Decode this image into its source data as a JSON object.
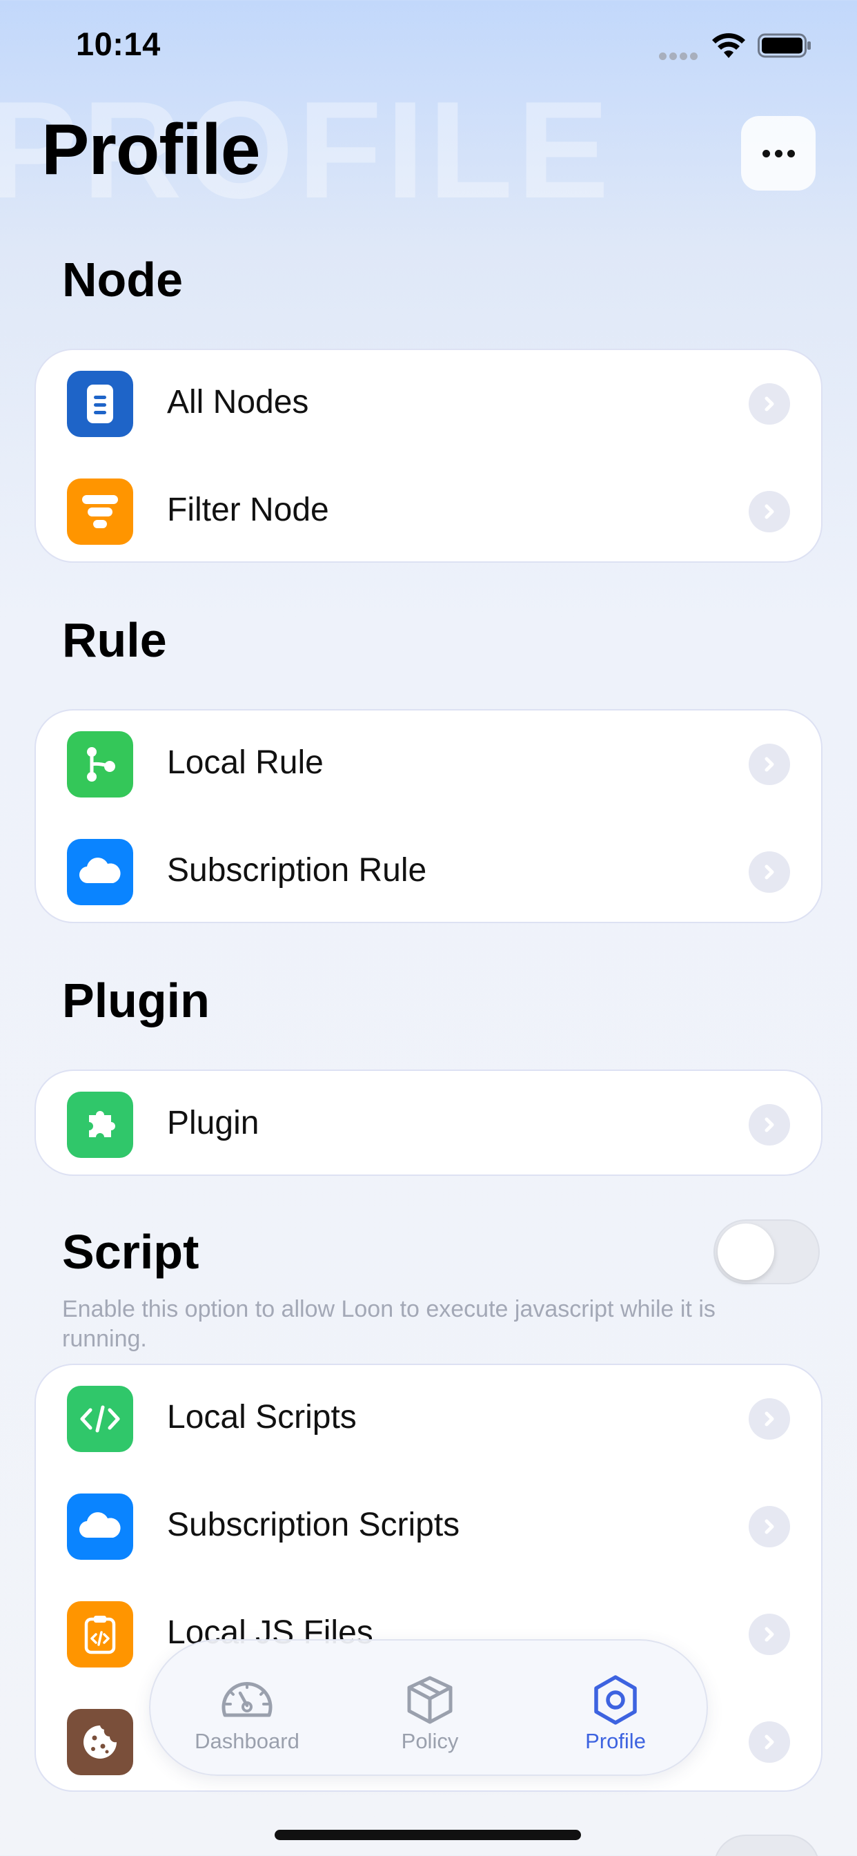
{
  "status_bar": {
    "time": "10:14"
  },
  "header": {
    "watermark": "PROFILE",
    "title": "Profile"
  },
  "sections": {
    "node": {
      "title": "Node",
      "items": [
        {
          "label": "All Nodes",
          "icon": "phone-node-icon",
          "color": "#1e64c8"
        },
        {
          "label": "Filter Node",
          "icon": "filter-icon",
          "color": "#ff9500"
        }
      ]
    },
    "rule": {
      "title": "Rule",
      "items": [
        {
          "label": "Local Rule",
          "icon": "branch-icon",
          "color": "#34c759"
        },
        {
          "label": "Subscription Rule",
          "icon": "cloud-icon",
          "color": "#0a84ff"
        }
      ]
    },
    "plugin": {
      "title": "Plugin",
      "items": [
        {
          "label": "Plugin",
          "icon": "puzzle-icon",
          "color": "#30c76a"
        }
      ]
    },
    "script": {
      "title": "Script",
      "toggle_on": false,
      "description": "Enable this option to allow Loon to execute javascript while it is running.",
      "items": [
        {
          "label": "Local Scripts",
          "icon": "code-icon",
          "color": "#30c76a"
        },
        {
          "label": "Subscription Scripts",
          "icon": "cloud-icon",
          "color": "#0a84ff"
        },
        {
          "label": "Local JS Files",
          "icon": "clipboard-code-icon",
          "color": "#ff9500"
        },
        {
          "label": "",
          "icon": "cookie-icon",
          "color": "#7a4f3a"
        }
      ]
    }
  },
  "tab_bar": {
    "tabs": [
      {
        "label": "Dashboard",
        "icon": "gauge-icon",
        "active": false
      },
      {
        "label": "Policy",
        "icon": "cube-icon",
        "active": false
      },
      {
        "label": "Profile",
        "icon": "gear-icon",
        "active": true
      }
    ],
    "active_color": "#3d63e0",
    "inactive_color": "#9aa0ad"
  }
}
